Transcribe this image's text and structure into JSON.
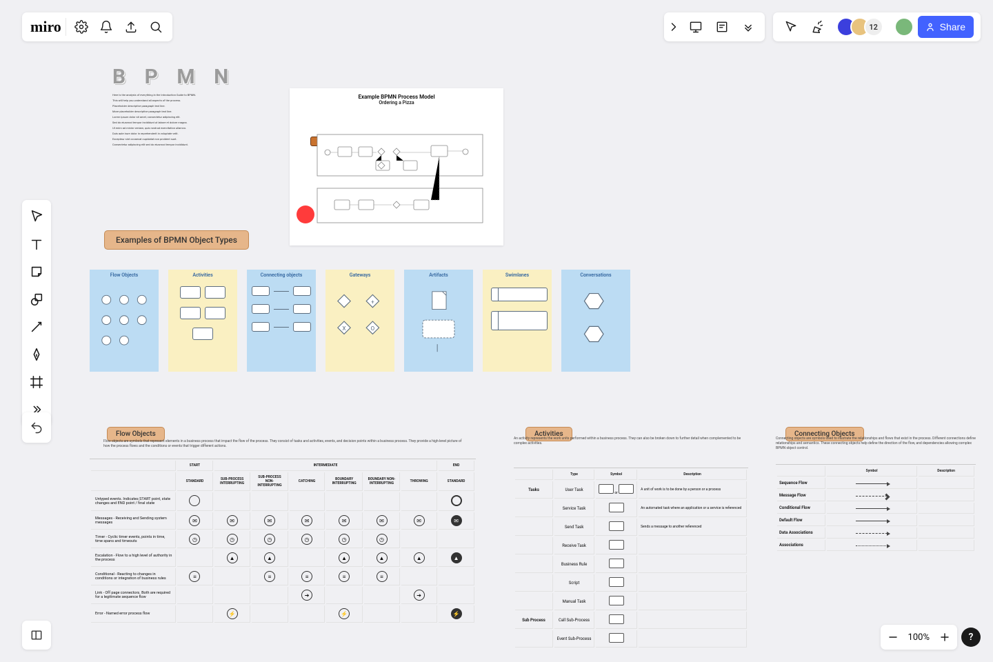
{
  "app": {
    "logo": "miro"
  },
  "topbar": {
    "settings_label": "Settings",
    "notifications_label": "Notifications",
    "export_label": "Export",
    "search_label": "Search"
  },
  "right_cluster": {
    "present_label": "Present",
    "comments_label": "Comments",
    "more_label": "More",
    "cursor_label": "Hide collaborators' cursors",
    "reactions_label": "Reactions",
    "avatar_overflow": "12",
    "share_label": "Share"
  },
  "side_tools": {
    "select": "Select",
    "text": "Text",
    "sticky": "Sticky note",
    "shape": "Shape",
    "line": "Connection line",
    "pen": "Pen",
    "frame": "Frame",
    "more": "More tools",
    "undo": "Undo"
  },
  "bottom_left": {
    "label": "Open frames"
  },
  "zoom": {
    "level": "100%",
    "help": "?"
  },
  "canvas": {
    "bpmn_title": "B P M N",
    "bpmn_desc_lines": [
      "Here is the analysis of everything in the Introduction Guide to BPMN.",
      "This will help you understand all aspects of the process.",
      "Placeholder descriptive paragraph text line.",
      "More placeholder descriptive paragraph text line.",
      "Lorem ipsum dolor sit amet, consectetur adipiscing elit.",
      "Sed do eiusmod tempor incididunt ut labore et dolore magna.",
      "Ut enim ad minim veniam, quis nostrud exercitation ullamco.",
      "Duis aute irure dolor in reprehenderit in voluptate velit.",
      "Excepteur sint occaecat cupidatat non proident sunt.",
      "Consectetur adipiscing elit sed do eiusmod tempor incididunt."
    ],
    "pizza": {
      "title": "Example BPMN Process Model",
      "subtitle": "Ordering a Pizza"
    },
    "examples_heading": "Examples of BPMN Object Types",
    "type_cards": [
      {
        "title": "Flow Objects",
        "color": "blue"
      },
      {
        "title": "Activities",
        "color": "yellow"
      },
      {
        "title": "Connecting objects",
        "color": "blue"
      },
      {
        "title": "Gateways",
        "color": "yellow"
      },
      {
        "title": "Artifacts",
        "color": "blue"
      },
      {
        "title": "Swimlanes",
        "color": "yellow"
      },
      {
        "title": "Conversations",
        "color": "blue"
      }
    ],
    "flow_section": {
      "heading": "Flow Objects",
      "desc": "Flow objects are symbols that represent elements in a business process that impact the flow of the process. They consist of tasks and activities, events, and decision points within a business process. They provide a high-level picture of how the process flows and the conditions or events that trigger different actions.",
      "group_headers": [
        "START",
        "INTERMEDIATE",
        "END"
      ],
      "col_headers": [
        "STANDARD",
        "SUB-PROCESS INTERRUPTING",
        "SUB-PROCESS NON-INTERRUPTING",
        "CATCHING",
        "BOUNDARY INTERRUPTING",
        "BOUNDARY NON-INTERRUPTING",
        "THROWING",
        "STANDARD"
      ],
      "rows": [
        {
          "label": "Untyped events. Indicates START point, state changes and END point / final state",
          "cells": [
            "o",
            "",
            "",
            "",
            "",
            "",
            "",
            "O"
          ]
        },
        {
          "label": "Messages - Receiving and Sending system messages",
          "cells": [
            "env",
            "env",
            "env",
            "env",
            "env",
            "env",
            "env",
            "envF"
          ]
        },
        {
          "label": "Timer - Cyclic timer events, points in time, time spans and timeouts",
          "cells": [
            "clk",
            "clk",
            "clk",
            "clk",
            "clk",
            "clk",
            "",
            ""
          ]
        },
        {
          "label": "Escalation - Flow to a high level of authority in the process",
          "cells": [
            "",
            "esc",
            "esc",
            "",
            "esc",
            "esc",
            "esc",
            "escF"
          ]
        },
        {
          "label": "Conditional - Reacting to changes in conditions or integration of business rules",
          "cells": [
            "cond",
            "",
            "cond",
            "cond",
            "cond",
            "cond",
            "",
            ""
          ]
        },
        {
          "label": "Link - Off page connectors. Both are required for a legitimate sequence flow",
          "cells": [
            "",
            "",
            "",
            "link",
            "",
            "",
            "link",
            ""
          ]
        },
        {
          "label": "Error - Named error process flow",
          "cells": [
            "",
            "err",
            "",
            "",
            "err",
            "",
            "",
            "errF"
          ]
        }
      ]
    },
    "activities_section": {
      "heading": "Activities",
      "desc": "An activity represents the work units performed within a business process. They can also be broken down to further detail when complemented to be complex activities.",
      "col_headers": [
        "Type",
        "Symbol",
        "Description"
      ],
      "rows": [
        {
          "type_group": "Tasks",
          "type": "User Task",
          "desc": "A unit of work is to be done by a person or a process"
        },
        {
          "type_group": "",
          "type": "Service Task",
          "desc": "An automated task where an application or a service is referenced"
        },
        {
          "type_group": "",
          "type": "Send Task",
          "desc": "Sends a message to another referenced"
        },
        {
          "type_group": "",
          "type": "Receive Task",
          "desc": ""
        },
        {
          "type_group": "",
          "type": "Business Rule",
          "desc": ""
        },
        {
          "type_group": "",
          "type": "Script",
          "desc": ""
        },
        {
          "type_group": "",
          "type": "Manual Task",
          "desc": ""
        },
        {
          "type_group": "Sub Process",
          "type": "Call Sub-Process",
          "desc": ""
        },
        {
          "type_group": "",
          "type": "Event Sub-Process",
          "desc": ""
        }
      ]
    },
    "connecting_section": {
      "heading": "Connecting Objects",
      "desc": "Connecting objects are symbols used to illustrate the relationships and flows that exist in the process. Different connections define relationships and semantics. These connecting objects help define the direction of the flow, and dependencies allowing complex BPMN object control.",
      "col_headers": [
        "",
        "Symbol",
        "Description"
      ],
      "rows": [
        {
          "name": "Sequence Flow",
          "line": "solid",
          "desc": ""
        },
        {
          "name": "Message Flow",
          "line": "dashed-open",
          "desc": ""
        },
        {
          "name": "Conditional Flow",
          "line": "solid-diamond",
          "desc": ""
        },
        {
          "name": "Default Flow",
          "line": "solid-slash",
          "desc": ""
        },
        {
          "name": "Data Associations",
          "line": "dotted",
          "desc": ""
        },
        {
          "name": "Associations",
          "line": "dotted-noarrow",
          "desc": ""
        }
      ]
    }
  }
}
